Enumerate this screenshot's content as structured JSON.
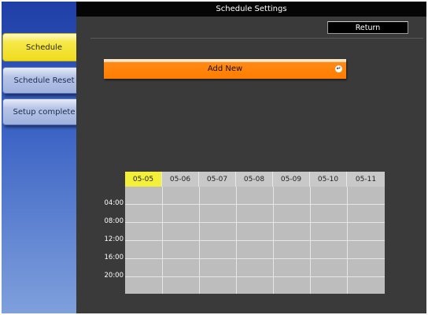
{
  "window": {
    "title": "Schedule Settings"
  },
  "sidebar": {
    "items": [
      {
        "label": "Schedule",
        "active": true
      },
      {
        "label": "Schedule Reset",
        "active": false
      },
      {
        "label": "Setup complete",
        "active": false
      }
    ]
  },
  "toolbar": {
    "return_label": "Return"
  },
  "add_new": {
    "label": "Add New",
    "icon": "enter-icon"
  },
  "calendar": {
    "dates": [
      "05-05",
      "05-06",
      "05-07",
      "05-08",
      "05-09",
      "05-10",
      "05-11"
    ],
    "highlighted_date": "05-05",
    "times": [
      "04:00",
      "08:00",
      "12:00",
      "16:00",
      "20:00"
    ]
  },
  "colors": {
    "accent_orange": "#ff7d00",
    "active_tab_yellow": "#f0dc1e",
    "background_dark": "#3a3a3a"
  }
}
